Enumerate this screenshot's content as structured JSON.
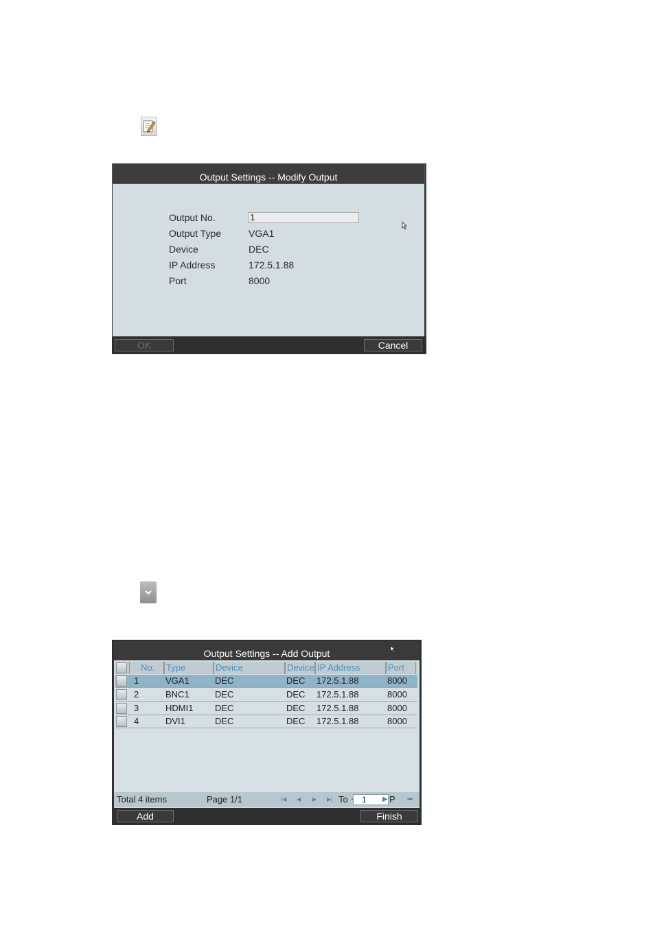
{
  "modify_dialog": {
    "title": "Output Settings -- Modify Output",
    "fields": [
      {
        "label": "Output No.",
        "value": "1"
      },
      {
        "label": "Output Type",
        "value": "VGA1"
      },
      {
        "label": "Device",
        "value": "DEC"
      },
      {
        "label": "IP Address",
        "value": "172.5.1.88"
      },
      {
        "label": "Port",
        "value": "8000"
      }
    ],
    "ok_label": "OK",
    "cancel_label": "Cancel"
  },
  "add_dialog": {
    "title": "Output Settings -- Add Output",
    "columns": [
      "No.",
      "Type",
      "Device",
      "Device",
      "IP Address",
      "Port"
    ],
    "rows": [
      {
        "no": "1",
        "type": "VGA1",
        "device": "DEC",
        "device2": "DEC",
        "ip": "172.5.1.88",
        "port": "8000"
      },
      {
        "no": "2",
        "type": "BNC1",
        "device": "DEC",
        "device2": "DEC",
        "ip": "172.5.1.88",
        "port": "8000"
      },
      {
        "no": "3",
        "type": "HDMI1",
        "device": "DEC",
        "device2": "DEC",
        "ip": "172.5.1.88",
        "port": "8000"
      },
      {
        "no": "4",
        "type": "DVI1",
        "device": "DEC",
        "device2": "DEC",
        "ip": "172.5.1.88",
        "port": "8000"
      }
    ],
    "total": "Total 4 items",
    "page": "Page 1/1",
    "to_label": "To",
    "to_value": "1",
    "p_label": "P",
    "add_label": "Add",
    "finish_label": "Finish"
  },
  "icons": {
    "edit": "edit-icon",
    "dropdown": "chevron-down-icon"
  }
}
